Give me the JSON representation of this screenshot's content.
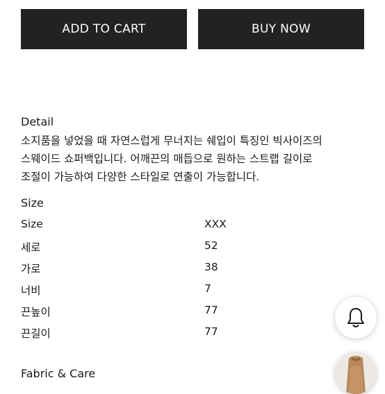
{
  "actions": {
    "add_to_cart": "ADD TO CART",
    "buy_now": "BUY NOW"
  },
  "detail": {
    "title": "Detail",
    "lines": [
      "소지품을 넣었을 때 자연스럽게 무너지는 쉐입이 특징인 빅사이즈의",
      "스웨이드 쇼퍼백입니다. 어깨끈의 매듭으로 원하는 스트랩 길이로",
      "조절이 가능하여 다양한 스타일로 연출이 가능합니다."
    ]
  },
  "size": {
    "title": "Size",
    "rows": [
      {
        "label": "Size",
        "value": "XXX"
      },
      {
        "label": "세로",
        "value": "52"
      },
      {
        "label": "가로",
        "value": "38"
      },
      {
        "label": "너비",
        "value": "7"
      },
      {
        "label": "끈높이",
        "value": "77"
      },
      {
        "label": "끈길이",
        "value": "77"
      }
    ]
  },
  "fabric": {
    "title": "Fabric & Care"
  },
  "floating": {
    "bell_icon": "bell-icon",
    "thumbnail_icon": "bag-thumbnail",
    "thumbnail_color": "#b7875a"
  }
}
